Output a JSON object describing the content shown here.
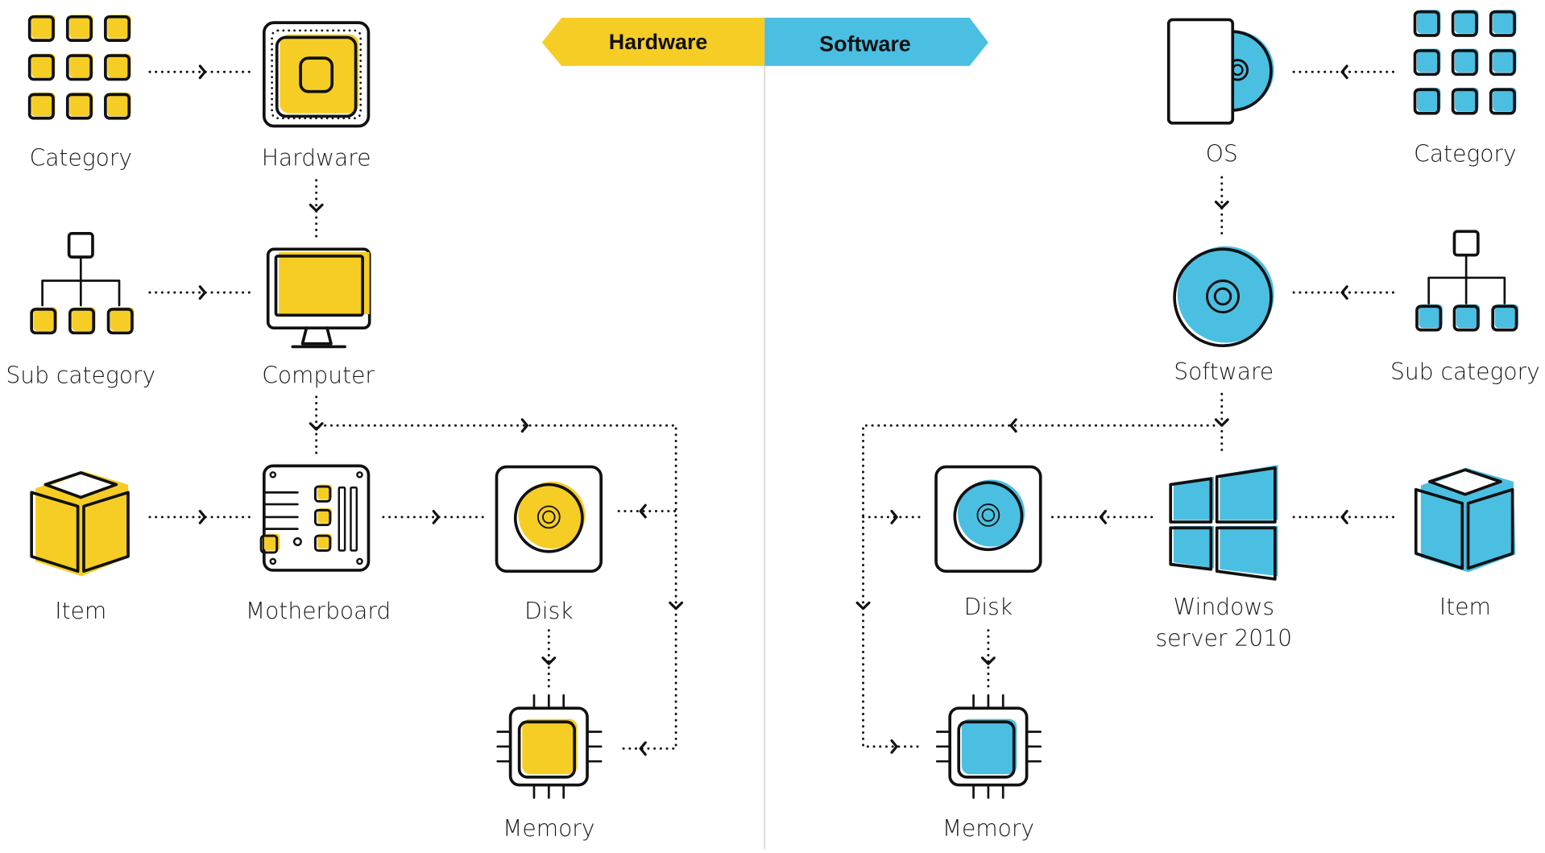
{
  "colors": {
    "hardware_accent": "#F6CD24",
    "software_accent": "#4BBFE2",
    "ink": "#111111",
    "divider": "#D8D8D8"
  },
  "header": {
    "hardware_tab": "Hardware",
    "software_tab": "Software"
  },
  "hardware": {
    "nodes": {
      "category": {
        "label": "Category",
        "icon": "grid-icon"
      },
      "hardware": {
        "label": "Hardware",
        "icon": "chip-icon"
      },
      "sub_category": {
        "label": "Sub category",
        "icon": "hierarchy-icon"
      },
      "computer": {
        "label": "Computer",
        "icon": "monitor-icon"
      },
      "item": {
        "label": "Item",
        "icon": "box-icon"
      },
      "motherboard": {
        "label": "Motherboard",
        "icon": "motherboard-icon"
      },
      "disk": {
        "label": "Disk",
        "icon": "disk-drive-icon"
      },
      "memory": {
        "label": "Memory",
        "icon": "memory-chip-icon"
      }
    },
    "edges": [
      {
        "from": "category",
        "to": "hardware"
      },
      {
        "from": "hardware",
        "to": "computer"
      },
      {
        "from": "sub_category",
        "to": "computer"
      },
      {
        "from": "computer",
        "to": "motherboard"
      },
      {
        "from": "computer",
        "to": "disk"
      },
      {
        "from": "computer",
        "to": "memory"
      },
      {
        "from": "item",
        "to": "motherboard"
      },
      {
        "from": "motherboard",
        "to": "disk"
      },
      {
        "from": "disk",
        "to": "memory"
      }
    ]
  },
  "software": {
    "nodes": {
      "os": {
        "label": "OS",
        "icon": "os-box-disc-icon"
      },
      "category": {
        "label": "Category",
        "icon": "grid-icon"
      },
      "software": {
        "label": "Software",
        "icon": "cd-icon"
      },
      "sub_category": {
        "label": "Sub category",
        "icon": "hierarchy-icon"
      },
      "disk": {
        "label": "Disk",
        "icon": "disk-drive-icon"
      },
      "windows": {
        "label_line1": "Windows",
        "label_line2": "server 2010",
        "icon": "windows-logo-icon"
      },
      "item": {
        "label": "Item",
        "icon": "box-icon"
      },
      "memory": {
        "label": "Memory",
        "icon": "memory-chip-icon"
      }
    },
    "edges": [
      {
        "from": "category",
        "to": "os"
      },
      {
        "from": "os",
        "to": "software"
      },
      {
        "from": "sub_category",
        "to": "software"
      },
      {
        "from": "software",
        "to": "windows"
      },
      {
        "from": "software",
        "to": "disk"
      },
      {
        "from": "software",
        "to": "memory"
      },
      {
        "from": "item",
        "to": "windows"
      },
      {
        "from": "windows",
        "to": "disk"
      },
      {
        "from": "disk",
        "to": "memory"
      }
    ]
  }
}
